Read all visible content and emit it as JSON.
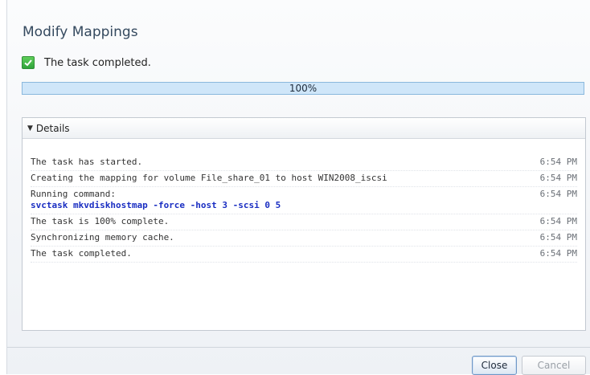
{
  "dialog": {
    "title": "Modify Mappings",
    "status_text": "The task completed.",
    "progress": {
      "label": "100%",
      "percent": 100
    },
    "details": {
      "header": "Details",
      "log": [
        {
          "message": "The task has started.",
          "time": "6:54 PM"
        },
        {
          "message": "Creating the mapping for volume File_share_01 to host WIN2008_iscsi",
          "time": "6:54 PM"
        },
        {
          "message": "Running command:",
          "command": "svctask mkvdiskhostmap -force -host 3 -scsi 0 5",
          "time": "6:54 PM"
        },
        {
          "message": "The task is 100% complete.",
          "time": "6:54 PM"
        },
        {
          "message": "Synchronizing memory cache.",
          "time": "6:54 PM"
        },
        {
          "message": "The task completed.",
          "time": "6:54 PM"
        }
      ]
    },
    "buttons": {
      "close": "Close",
      "cancel": "Cancel"
    }
  },
  "colors": {
    "accent": "#34495e",
    "command": "#1a2ec2",
    "success": "#2fa33a",
    "progress_bg": "#d5ebfb"
  },
  "icons": {
    "status": "check-icon",
    "details_toggle": "caret-down-icon"
  }
}
